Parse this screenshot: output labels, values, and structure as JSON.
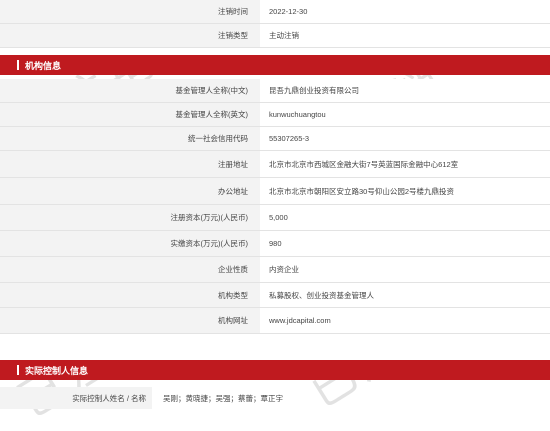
{
  "top_rows": [
    {
      "label": "注销时间",
      "value": "2022-12-30"
    },
    {
      "label": "注销类型",
      "value": "主动注销"
    }
  ],
  "org_section": {
    "title": "机构信息"
  },
  "org_rows": [
    {
      "label": "基金管理人全称(中文)",
      "value": "昆吾九鼎创业投资有限公司"
    },
    {
      "label": "基金管理人全称(英文)",
      "value": "kunwuchuangtou"
    },
    {
      "label": "统一社会信用代码",
      "value": "55307265-3"
    },
    {
      "label": "注册地址",
      "value": "北京市北京市西城区金融大街7号英蓝国际金融中心612室"
    },
    {
      "label": "办公地址",
      "value": "北京市北京市朝阳区安立路30号仰山公园2号楼九鼎投资"
    },
    {
      "label": "注册资本(万元)(人民币)",
      "value": "5,000"
    },
    {
      "label": "实缴资本(万元)(人民币)",
      "value": "980"
    },
    {
      "label": "企业性质",
      "value": "内资企业"
    },
    {
      "label": "机构类型",
      "value": "私募股权、创业投资基金管理人"
    },
    {
      "label": "机构网址",
      "value": "www.jdcapital.com"
    }
  ],
  "controller_section": {
    "title": "实际控制人信息"
  },
  "controller_row": {
    "label": "实际控制人姓名 / 名称",
    "value": "吴刚；黄晓捷；吴强；蔡蕾；覃正宇"
  },
  "watermark_text": "已注销",
  "colors": {
    "accent": "#bf1a1f",
    "label_bg": "#f3f3f3",
    "border": "#e3e3e3"
  }
}
